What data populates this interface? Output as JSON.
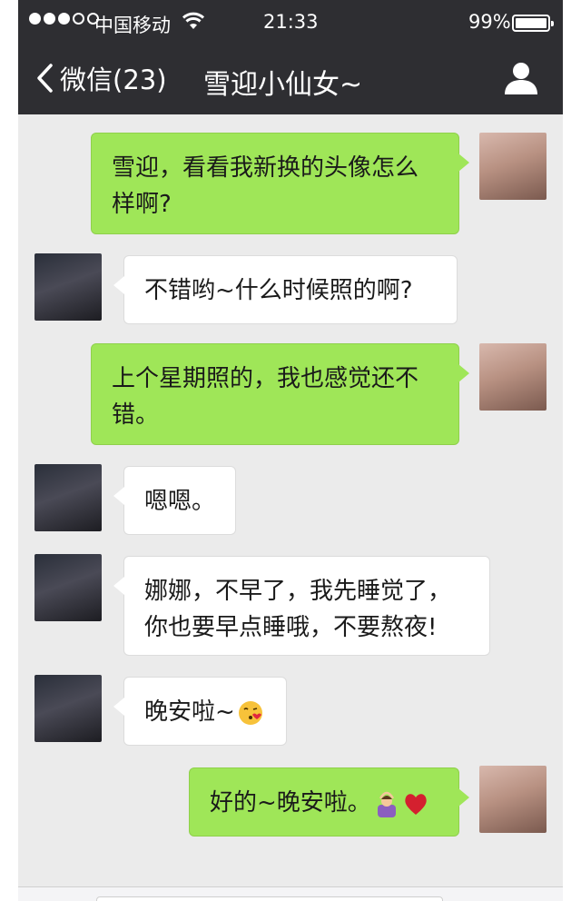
{
  "status_bar": {
    "carrier": "中国移动",
    "time": "21:33",
    "battery": "99%"
  },
  "nav": {
    "back_label": "微信(23)",
    "title": "雪迎小仙女~"
  },
  "messages": [
    {
      "sender": "me",
      "text": "雪迎，看看我新换的头像怎么样啊?"
    },
    {
      "sender": "them",
      "text": "不错哟~什么时候照的啊?"
    },
    {
      "sender": "me",
      "text": "上个星期照的，我也感觉还不错。"
    },
    {
      "sender": "them",
      "text": "嗯嗯。"
    },
    {
      "sender": "them",
      "text": "娜娜，不早了，我先睡觉了，你也要早点睡哦，不要熬夜!"
    },
    {
      "sender": "them",
      "text": "晚安啦~",
      "emoji": "kissing-face-emoji"
    },
    {
      "sender": "me",
      "text": "好的~晚安啦。",
      "emoji": [
        "person-gesturing-ok-emoji",
        "red-heart-emoji"
      ]
    }
  ],
  "colors": {
    "header_bg": "#2e2e32",
    "chat_bg": "#ebebeb",
    "outgoing_bubble": "#9fe658",
    "incoming_bubble": "#ffffff"
  }
}
